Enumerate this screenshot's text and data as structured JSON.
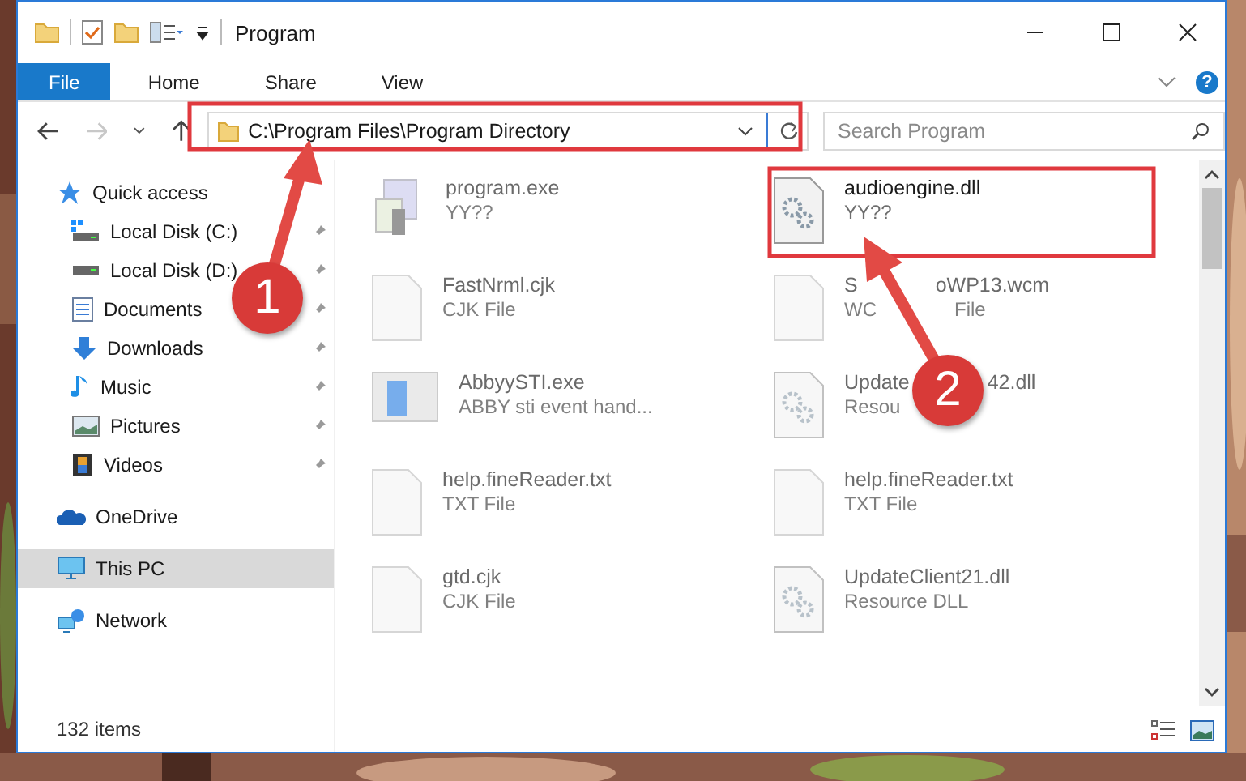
{
  "window": {
    "title": "Program"
  },
  "ribbon": {
    "tabs": [
      {
        "label": "File",
        "selected": true
      },
      {
        "label": "Home",
        "selected": false
      },
      {
        "label": "Share",
        "selected": false
      },
      {
        "label": "View",
        "selected": false
      }
    ],
    "help": "?"
  },
  "navigation": {
    "forward_disabled": true
  },
  "address": {
    "path": "C:\\Program Files\\Program Directory"
  },
  "search": {
    "placeholder": "Search Program"
  },
  "sidebar": {
    "items": [
      {
        "label": "Quick access",
        "kind": "star",
        "selected": false,
        "children": [
          {
            "label": "Local Disk (C:)",
            "kind": "system-drive",
            "pinned": true
          },
          {
            "label": "Local Disk (D:)",
            "kind": "drive",
            "pinned": true
          },
          {
            "label": "Documents",
            "kind": "documents",
            "pinned": true
          },
          {
            "label": "Downloads",
            "kind": "downloads",
            "pinned": true
          },
          {
            "label": "Music",
            "kind": "music",
            "pinned": true
          },
          {
            "label": "Pictures",
            "kind": "pictures",
            "pinned": true
          },
          {
            "label": "Videos",
            "kind": "videos",
            "pinned": true
          }
        ]
      },
      {
        "label": "OneDrive",
        "kind": "cloud",
        "selected": false
      },
      {
        "label": "This PC",
        "kind": "computer",
        "selected": true
      },
      {
        "label": "Network",
        "kind": "network",
        "selected": false
      }
    ]
  },
  "files": [
    {
      "name": "program.exe",
      "type": "YY??",
      "kind": "installer",
      "dimmed": true
    },
    {
      "name": "audioengine.dll",
      "type": "YY??",
      "kind": "gears",
      "dimmed": false
    },
    {
      "name": "FastNrml.cjk",
      "type": "CJK File",
      "kind": "blank",
      "dimmed": true
    },
    {
      "name": "S",
      "name_tail": "oWP13.wcm",
      "type": "WC",
      "type_tail": "File",
      "kind": "blank",
      "dimmed": true
    },
    {
      "name": "AbbyySTI.exe",
      "type": "ABBY sti event hand...",
      "kind": "window",
      "dimmed": true
    },
    {
      "name": "Update",
      "name_tail": "42.dll",
      "type": "Resou",
      "kind": "gears",
      "dimmed": true
    },
    {
      "name": "help.fineReader.txt",
      "type": "TXT File",
      "kind": "blank",
      "dimmed": true
    },
    {
      "name": "help.fineReader.txt",
      "type": "TXT File",
      "kind": "blank",
      "dimmed": true
    },
    {
      "name": "gtd.cjk",
      "type": "CJK File",
      "kind": "blank",
      "dimmed": true
    },
    {
      "name": "UpdateClient21.dll",
      "type": "Resource DLL",
      "kind": "gears",
      "dimmed": true
    }
  ],
  "status_bar": {
    "item_count": "132 items"
  },
  "annotations": [
    {
      "number": "1"
    },
    {
      "number": "2"
    }
  ]
}
